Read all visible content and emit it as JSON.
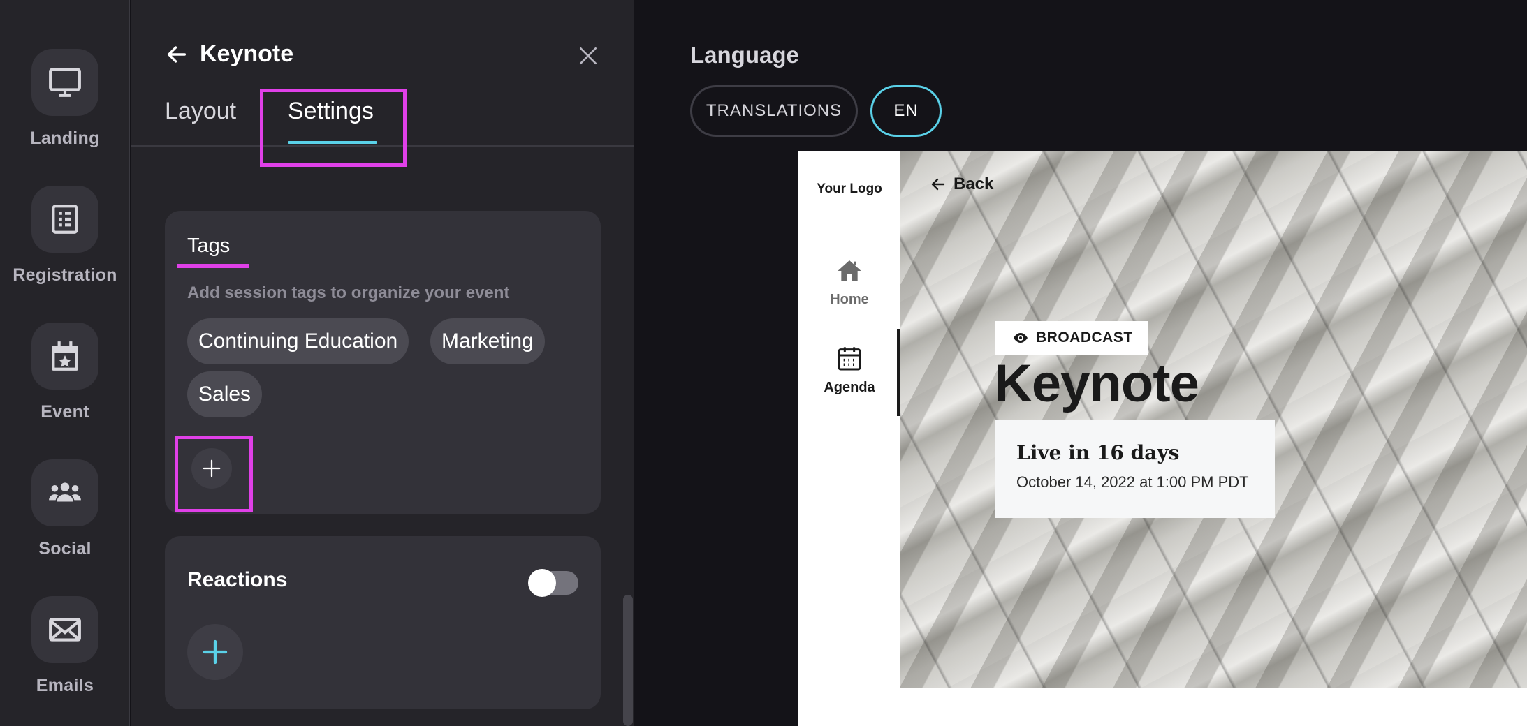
{
  "rail": {
    "items": [
      {
        "label": "Landing",
        "icon": "monitor-icon"
      },
      {
        "label": "Registration",
        "icon": "form-icon"
      },
      {
        "label": "Event",
        "icon": "calendar-star-icon"
      },
      {
        "label": "Social",
        "icon": "people-icon"
      },
      {
        "label": "Emails",
        "icon": "envelope-icon"
      }
    ]
  },
  "panel": {
    "title": "Keynote",
    "tabs": [
      {
        "label": "Layout",
        "active": false
      },
      {
        "label": "Settings",
        "active": true
      }
    ],
    "tags": {
      "title": "Tags",
      "help": "Add session tags to organize your event",
      "chips": [
        "Continuing Education",
        "Marketing",
        "Sales"
      ]
    },
    "reactions": {
      "title": "Reactions",
      "enabled": false
    }
  },
  "language": {
    "label": "Language",
    "translations_label": "TRANSLATIONS",
    "current": "EN"
  },
  "preview": {
    "logo": "Your Logo",
    "nav": [
      {
        "label": "Home",
        "icon": "home-icon"
      },
      {
        "label": "Agenda",
        "icon": "calendar-icon"
      }
    ],
    "back_label": "Back",
    "badge": "BROADCAST",
    "title": "Keynote",
    "live": "Live in 16 days",
    "date": "October 14, 2022 at 1:00 PM PDT"
  },
  "colors": {
    "accent": "#5ad1e8",
    "highlight": "#e040e8",
    "panel": "#252429",
    "card": "#333239"
  }
}
